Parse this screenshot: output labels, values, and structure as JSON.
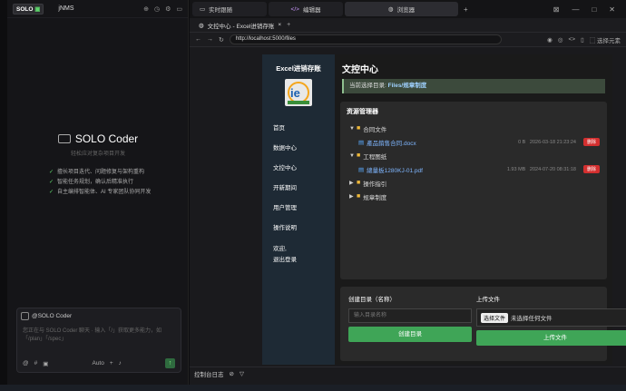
{
  "left": {
    "logo": "SOLO",
    "project": "jNMS",
    "brand": "SOLO Coder",
    "subtitle": "轻松应对复杂项目开发",
    "features": [
      "擅长项目迭代、问题修复与架构重构",
      "智能任务规划，确认后精准执行",
      "自主编排智能体、AI 专家团队协同开发"
    ],
    "input_tag": "@SOLO Coder",
    "input_placeholder": "您正在与 SOLO Coder 聊天 · 输入「/」获取更多能力，如「/plan」「/spec」",
    "mode": "Auto"
  },
  "tabs": [
    {
      "label": "实时跟随"
    },
    {
      "label": "编辑器"
    },
    {
      "label": "浏览器"
    }
  ],
  "browser_tab": "文控中心 - Excel进销存账",
  "url": "http://localhost:5000/files",
  "select_element": "选择元素",
  "sidebar": {
    "title": "Excel进销存账",
    "items": [
      "首页",
      "数据中心",
      "文控中心",
      "开新期间",
      "用户管理",
      "操作说明"
    ],
    "welcome": "欢迎,",
    "logout": "退出登录"
  },
  "page_title": "文控中心",
  "alert": {
    "prefix": "当前选择目录:",
    "path": "Files/规章制度"
  },
  "resource": {
    "title": "资源管理器",
    "tree": [
      {
        "type": "folder",
        "name": "合同文件",
        "open": true,
        "level": 0
      },
      {
        "type": "file",
        "name": "產品銷售合同.docx",
        "size": "0 B",
        "date": "2026-03-18 21:23:24",
        "level": 1
      },
      {
        "type": "folder",
        "name": "工程图纸",
        "open": true,
        "level": 0
      },
      {
        "type": "file",
        "name": "總量板1280KJ-01.pdf",
        "size": "1.93 MB",
        "date": "2024-07-20 08:31:18",
        "level": 1
      },
      {
        "type": "folder",
        "name": "操作指引",
        "open": false,
        "level": 0
      },
      {
        "type": "folder",
        "name": "规章制度",
        "open": false,
        "level": 0
      }
    ],
    "delete_label": "删除"
  },
  "create_dir": {
    "label": "创建目录（名称）",
    "placeholder": "输入目录名称",
    "button": "创建目录"
  },
  "upload": {
    "label": "上传文件",
    "choose": "选择文件",
    "none": "未选择任何文件",
    "button": "上传文件"
  },
  "console": "控制台日志"
}
